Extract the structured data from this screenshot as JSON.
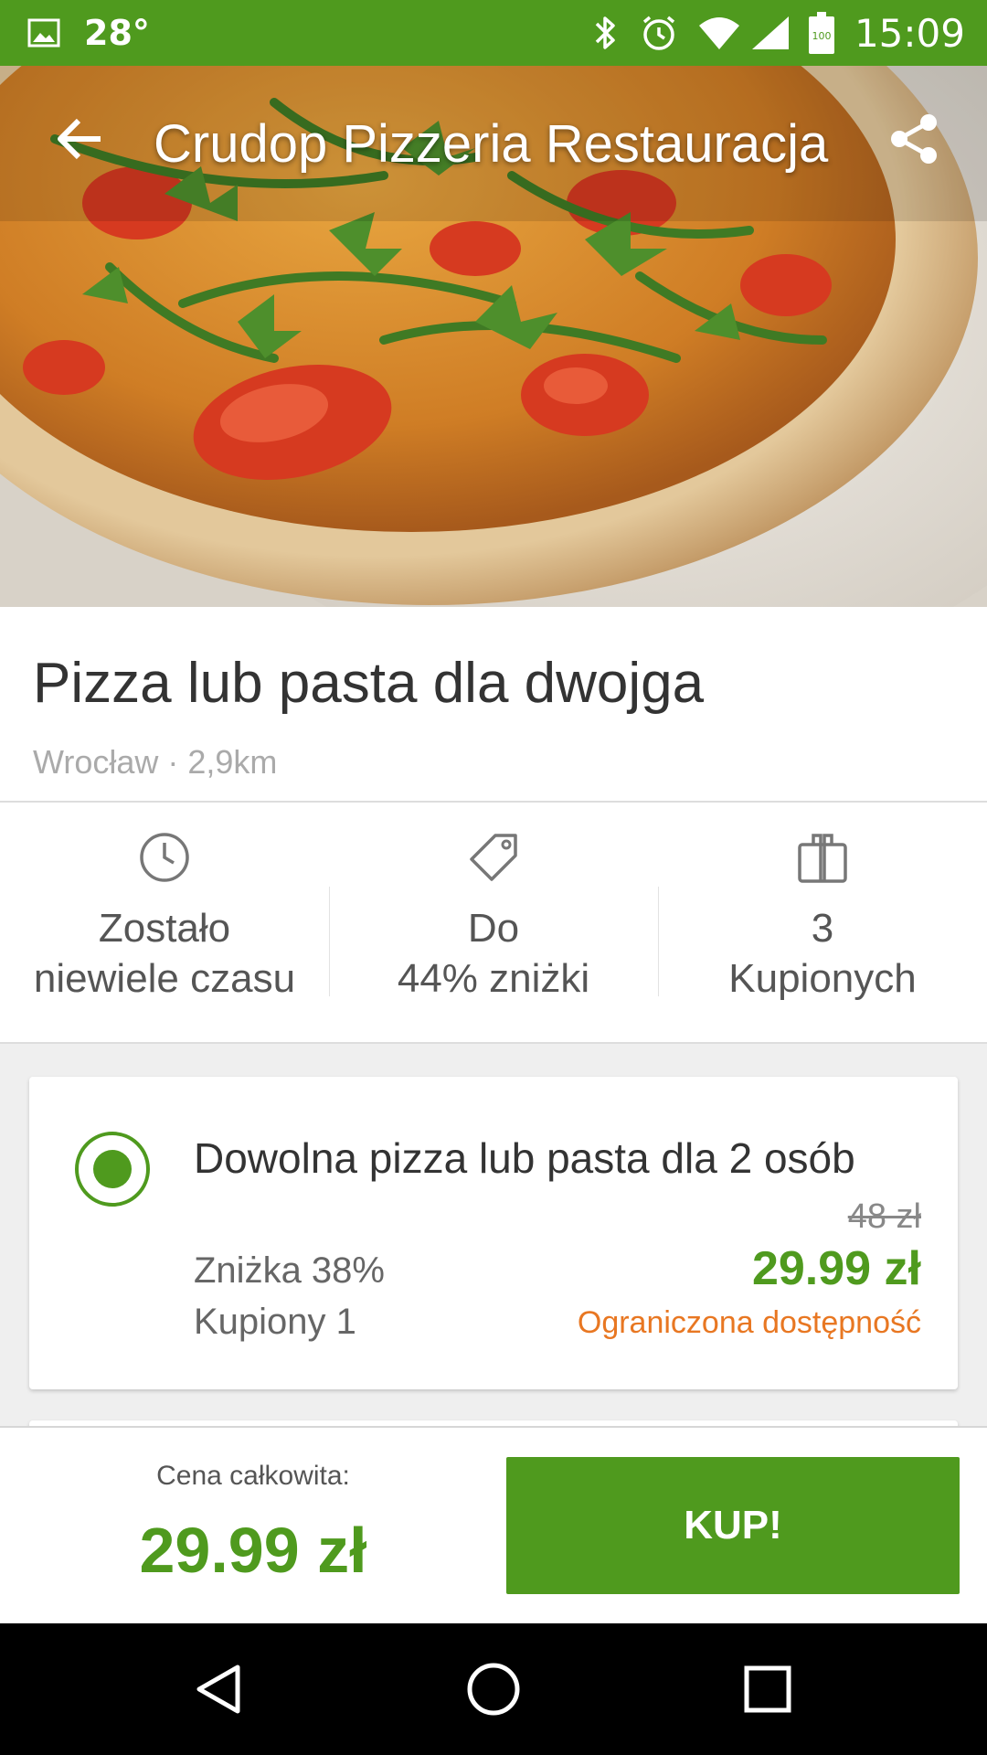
{
  "status_bar": {
    "temperature": "28°",
    "time": "15:09",
    "battery": "100",
    "icons": [
      "gallery-icon",
      "bluetooth-icon",
      "alarm-icon",
      "wifi-icon",
      "signal-icon",
      "battery-icon"
    ]
  },
  "toolbar": {
    "title": "Crudop Pizzeria Restauracja",
    "back_icon": "arrow-back-icon",
    "share_icon": "share-icon"
  },
  "deal": {
    "title": "Pizza lub pasta dla dwojga",
    "location": "Wrocław · 2,9km"
  },
  "stats": [
    {
      "icon": "clock-icon",
      "line1": "Zostało",
      "line2": "niewiele czasu"
    },
    {
      "icon": "tag-icon",
      "line1": "Do",
      "line2": "44% zniżki"
    },
    {
      "icon": "shopping-bag-icon",
      "line1": "3",
      "line2": "Kupionych"
    }
  ],
  "option": {
    "selected": true,
    "title": "Dowolna pizza lub pasta dla 2 osób",
    "old_price": "48 zł",
    "discount": "Zniżka 38%",
    "bought": "Kupiony 1",
    "price": "29.99 zł",
    "availability": "Ograniczona dostępność"
  },
  "buy_bar": {
    "total_label": "Cena całkowita:",
    "total_price": "29.99 zł",
    "buy_label": "KUP!"
  },
  "nav_bar": {
    "icons": [
      "nav-back-icon",
      "nav-home-icon",
      "nav-recents-icon"
    ]
  },
  "colors": {
    "brand_green": "#4f9a1e",
    "availability_orange": "#e87722"
  }
}
